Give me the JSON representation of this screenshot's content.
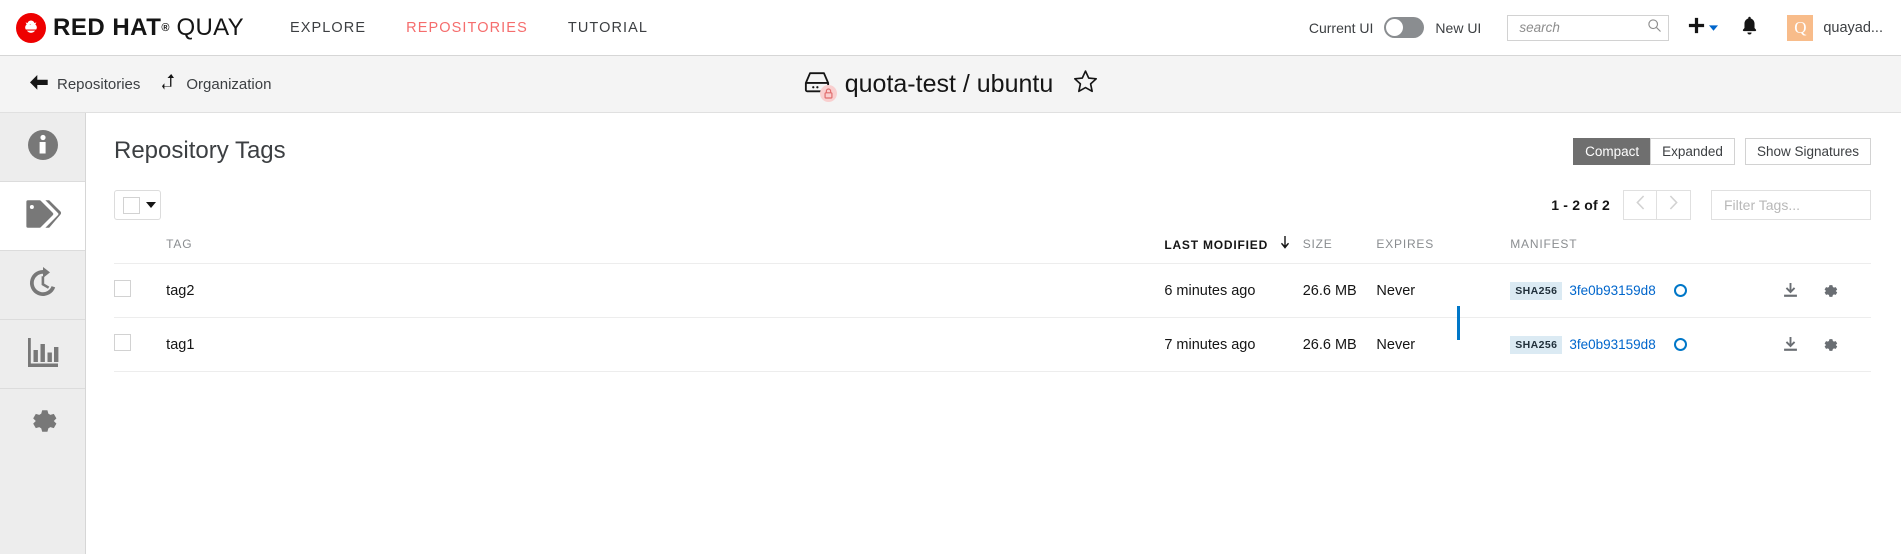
{
  "topnav": {
    "brand_redhat": "RED HAT",
    "brand_reg": "®",
    "brand_quay": "QUAY",
    "links": [
      {
        "label": "EXPLORE",
        "active": false
      },
      {
        "label": "REPOSITORIES",
        "active": true
      },
      {
        "label": "TUTORIAL",
        "active": false
      }
    ],
    "toggle": {
      "left_label": "Current UI",
      "right_label": "New UI",
      "state": "off",
      "track_color": "#8a8d90"
    },
    "search": {
      "placeholder": "search",
      "value": ""
    },
    "icons": {
      "search": "search-icon",
      "plus": "plus-icon",
      "bell": "bell-icon"
    },
    "user": {
      "avatar_letter": "Q",
      "avatar_color": "#f8bc8a",
      "name": "quayad..."
    }
  },
  "titlebar": {
    "breadcrumbs": [
      {
        "label": "Repositories",
        "icon": "back-arrow-icon"
      },
      {
        "label": "Organization",
        "icon": "level-up-icon"
      }
    ],
    "repo": {
      "icon": "hard-drive-icon",
      "lock_badge": "lock-icon",
      "lock_badge_color": "#f9cfcf",
      "name": "quota-test / ubuntu",
      "star": "star-outline-icon"
    }
  },
  "sidebar": {
    "items": [
      {
        "name": "information",
        "icon": "info-circle-icon",
        "active": false
      },
      {
        "name": "tags",
        "icon": "tag-icon",
        "active": true
      },
      {
        "name": "history",
        "icon": "history-icon",
        "active": false
      },
      {
        "name": "usage-logs",
        "icon": "bar-chart-icon",
        "active": false
      },
      {
        "name": "settings",
        "icon": "gear-icon",
        "active": false
      }
    ]
  },
  "main": {
    "title": "Repository Tags",
    "view_buttons": [
      {
        "label": "Compact",
        "active": true
      },
      {
        "label": "Expanded",
        "active": false
      }
    ],
    "signatures_button": "Show Signatures",
    "toolbar": {
      "select_all": {
        "icon": "checkbox-icon",
        "caret": "caret-down-icon"
      },
      "page_count": "1 - 2 of 2",
      "prev_icon": "chevron-left-icon",
      "next_icon": "chevron-right-icon",
      "filter": {
        "placeholder": "Filter Tags...",
        "value": ""
      }
    },
    "table": {
      "columns": [
        {
          "key": "tag",
          "label": "TAG",
          "sorted": false
        },
        {
          "key": "last_modified",
          "label": "LAST MODIFIED",
          "sorted": true,
          "sort_icon": "arrow-down-icon"
        },
        {
          "key": "size",
          "label": "SIZE",
          "sorted": false
        },
        {
          "key": "expires",
          "label": "EXPIRES",
          "sorted": false
        },
        {
          "key": "manifest",
          "label": "MANIFEST",
          "sorted": false
        }
      ],
      "rows": [
        {
          "tag": "tag2",
          "last_modified": "6 minutes ago",
          "size": "26.6 MB",
          "expires": "Never",
          "manifest_badge": "SHA256",
          "manifest_digest": "3fe0b93159d8",
          "download_icon": "download-icon",
          "settings_icon": "gear-icon"
        },
        {
          "tag": "tag1",
          "last_modified": "7 minutes ago",
          "size": "26.6 MB",
          "expires": "Never",
          "manifest_badge": "SHA256",
          "manifest_digest": "3fe0b93159d8",
          "download_icon": "download-icon",
          "settings_icon": "gear-icon"
        }
      ],
      "link_color": "#0077c8"
    }
  }
}
